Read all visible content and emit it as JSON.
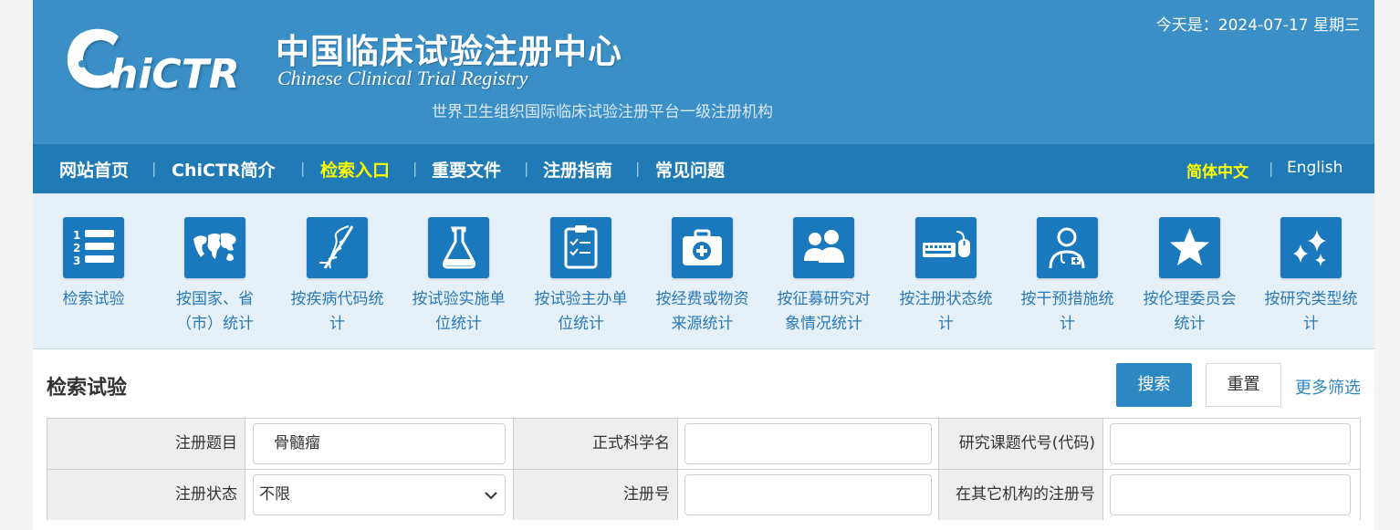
{
  "header": {
    "date_text": "今天是：2024-07-17 星期三",
    "logo_text": "ChiCTR",
    "title_cn": "中国临床试验注册中心",
    "title_en": "Chinese Clinical Trial Registry",
    "subtitle": "世界卫生组织国际临床试验注册平台一级注册机构"
  },
  "nav": {
    "items": [
      {
        "label": "网站首页"
      },
      {
        "label": "ChiCTR简介"
      },
      {
        "label": "检索入口"
      },
      {
        "label": "重要文件"
      },
      {
        "label": "注册指南"
      },
      {
        "label": "常见问题"
      }
    ],
    "separator": "|",
    "lang_cn": "简体中文",
    "lang_en": "English",
    "active_color": "#ffff00"
  },
  "categories": [
    {
      "line1": "检索试验",
      "line2": "",
      "icon": "list-icon"
    },
    {
      "line1": "按国家、省",
      "line2": "（市）统计",
      "icon": "world-map-icon"
    },
    {
      "line1": "按疾病代码统",
      "line2": "计",
      "icon": "dna-icon"
    },
    {
      "line1": "按试验实施单",
      "line2": "位统计",
      "icon": "flask-icon"
    },
    {
      "line1": "按试验主办单",
      "line2": "位统计",
      "icon": "clipboard-icon"
    },
    {
      "line1": "按经费或物资",
      "line2": "来源统计",
      "icon": "medical-kit-icon"
    },
    {
      "line1": "按征募研究对",
      "line2": "象情况统计",
      "icon": "people-icon"
    },
    {
      "line1": "按注册状态统",
      "line2": "计",
      "icon": "keyboard-mouse-icon"
    },
    {
      "line1": "按干预措施统",
      "line2": "计",
      "icon": "doctor-icon"
    },
    {
      "line1": "按伦理委员会",
      "line2": "统计",
      "icon": "star-icon"
    },
    {
      "line1": "按研究类型统",
      "line2": "计",
      "icon": "sparkle-icon"
    }
  ],
  "search": {
    "section_title": "检索试验",
    "search_button": "搜索",
    "reset_button": "重置",
    "more_filters": "更多筛选",
    "fields": {
      "reg_title_label": "注册题目",
      "reg_title_value": "骨髓瘤",
      "sci_name_label": "正式科学名",
      "sci_name_value": "",
      "project_code_label": "研究课题代号(代码)",
      "project_code_value": "",
      "status_label": "注册状态",
      "status_value": "不限",
      "reg_no_label": "注册号",
      "reg_no_value": "",
      "other_reg_label": "在其它机构的注册号",
      "other_reg_value": ""
    }
  },
  "colors": {
    "banner": "#3a8fc6",
    "nav": "#1f7ab6",
    "tile": "#1a78bd",
    "link": "#2a79b8"
  }
}
